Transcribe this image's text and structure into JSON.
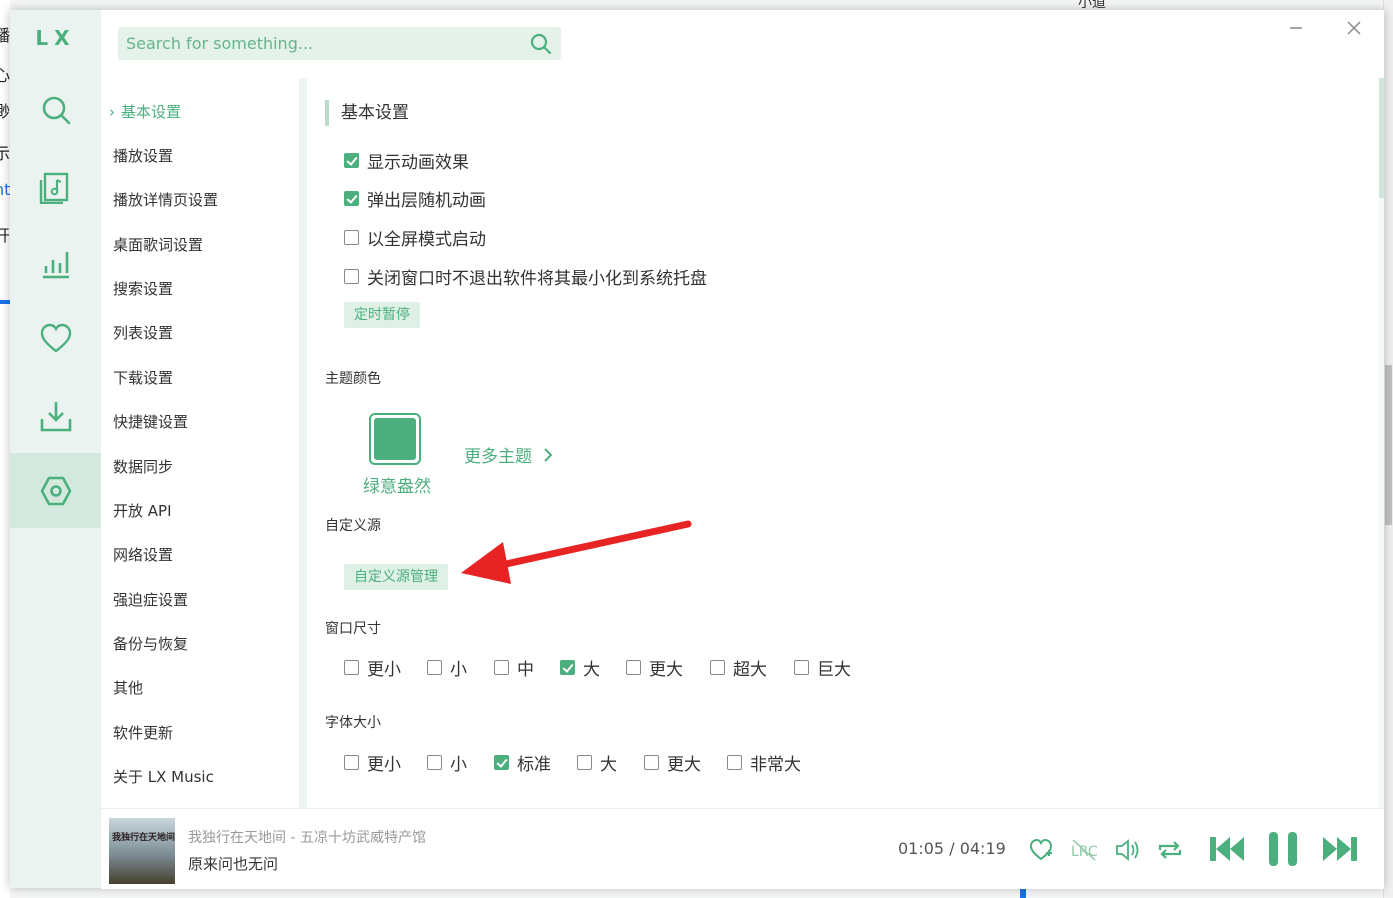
{
  "background": {
    "left_fragments": [
      "播",
      "心",
      "渺",
      "示",
      "ht",
      "开"
    ],
    "top_fragment": "小道"
  },
  "app": {
    "logo": "LX",
    "accent_color": "#4caf7e",
    "nav": [
      {
        "name": "search-nav",
        "icon": "search-icon"
      },
      {
        "name": "songlist-nav",
        "icon": "music-list-icon"
      },
      {
        "name": "leaderboard-nav",
        "icon": "chart-bars-icon"
      },
      {
        "name": "favorites-nav",
        "icon": "heart-icon"
      },
      {
        "name": "download-nav",
        "icon": "download-icon"
      },
      {
        "name": "settings-nav",
        "icon": "settings-hex-icon",
        "active": true
      }
    ],
    "search": {
      "placeholder": "Search for something..."
    }
  },
  "settings_menu": {
    "items": [
      "基本设置",
      "播放设置",
      "播放详情页设置",
      "桌面歌词设置",
      "搜索设置",
      "列表设置",
      "下载设置",
      "快捷键设置",
      "数据同步",
      "开放 API",
      "网络设置",
      "强迫症设置",
      "备份与恢复",
      "其他",
      "软件更新",
      "关于 LX Music"
    ],
    "active_index": 0
  },
  "basic": {
    "title": "基本设置",
    "options": [
      {
        "label": "显示动画效果",
        "checked": true
      },
      {
        "label": "弹出层随机动画",
        "checked": true
      },
      {
        "label": "以全屏模式启动",
        "checked": false
      },
      {
        "label": "关闭窗口时不退出软件将其最小化到系统托盘",
        "checked": false
      }
    ],
    "timer_button": "定时暂停"
  },
  "theme": {
    "label": "主题颜色",
    "current_name": "绿意盎然",
    "current_color": "#4caf7e",
    "more_label": "更多主题"
  },
  "custom_source": {
    "label": "自定义源",
    "button": "自定义源管理"
  },
  "window_size": {
    "label": "窗口尺寸",
    "options": [
      {
        "label": "更小",
        "checked": false
      },
      {
        "label": "小",
        "checked": false
      },
      {
        "label": "中",
        "checked": false
      },
      {
        "label": "大",
        "checked": true
      },
      {
        "label": "更大",
        "checked": false
      },
      {
        "label": "超大",
        "checked": false
      },
      {
        "label": "巨大",
        "checked": false
      }
    ]
  },
  "font_size": {
    "label": "字体大小",
    "options": [
      {
        "label": "更小",
        "checked": false
      },
      {
        "label": "小",
        "checked": false
      },
      {
        "label": "标准",
        "checked": true
      },
      {
        "label": "大",
        "checked": false
      },
      {
        "label": "更大",
        "checked": false
      },
      {
        "label": "非常大",
        "checked": false
      }
    ]
  },
  "player": {
    "cover_text": "我独行在天地间",
    "title": "我独行在天地间 - 五凉十坊武威特产馆",
    "lyric": "原来问也无问",
    "current_time": "01:05",
    "separator": "/",
    "total_time": "04:19",
    "controls": [
      "heart-icon",
      "lrc-icon",
      "volume-icon",
      "repeat-icon",
      "previous-icon",
      "pause-icon",
      "next-icon"
    ]
  },
  "annotation": {
    "arrow_color": "#e82323"
  }
}
